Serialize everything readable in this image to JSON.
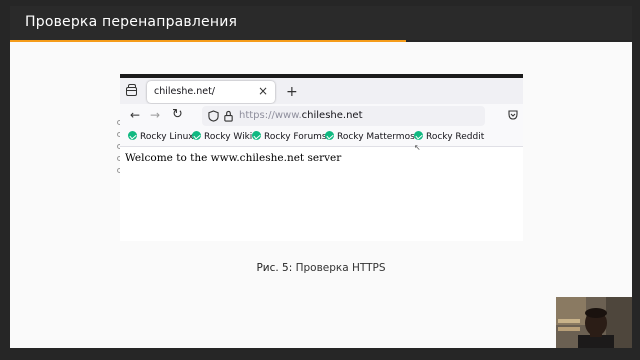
{
  "slide": {
    "title": "Проверка перенаправления",
    "caption_label": "Рис. 5:",
    "caption_text": "Проверка HTTPS",
    "accent_color": "#f59c1a"
  },
  "browser": {
    "tab_title": "chileshe.net/",
    "tab_close": "×",
    "new_tab": "+",
    "nav": {
      "back": "←",
      "forward": "→",
      "reload": "↻"
    },
    "url": {
      "prefix": "https://www.",
      "host": "chileshe.net"
    },
    "bookmarks": [
      {
        "label": "Rocky Linux"
      },
      {
        "label": "Rocky Wiki"
      },
      {
        "label": "Rocky Forums"
      },
      {
        "label": "Rocky Mattermost"
      },
      {
        "label": "Rocky Reddit"
      }
    ],
    "page_text": "Welcome to the www.chileshe.net server"
  }
}
